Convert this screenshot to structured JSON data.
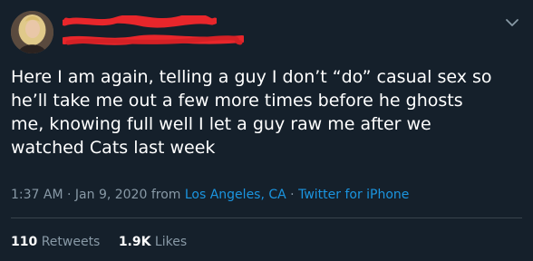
{
  "tweet": {
    "text": "Here I am again, telling a guy I don’t “do” casual sex so\nhe’ll take me out a few more times before he ghosts\nme, knowing full well I let a guy raw me after we\nwatched Cats last week",
    "time": "1:37 AM",
    "sep1": " · ",
    "date": "Jan 9, 2020",
    "from_label": " from ",
    "location": "Los Angeles, CA",
    "sep2": " · ",
    "client": "Twitter for iPhone"
  },
  "stats": {
    "retweets_count": "110",
    "retweets_label": "Retweets",
    "likes_count": "1.9K",
    "likes_label": "Likes"
  },
  "icons": {
    "menu": "chevron-down-icon"
  },
  "colors": {
    "background": "#15202b",
    "text": "#ffffff",
    "secondary_text": "#8899a6",
    "link": "#1b95e0",
    "divider": "#38444d",
    "redaction": "#e8262b"
  }
}
